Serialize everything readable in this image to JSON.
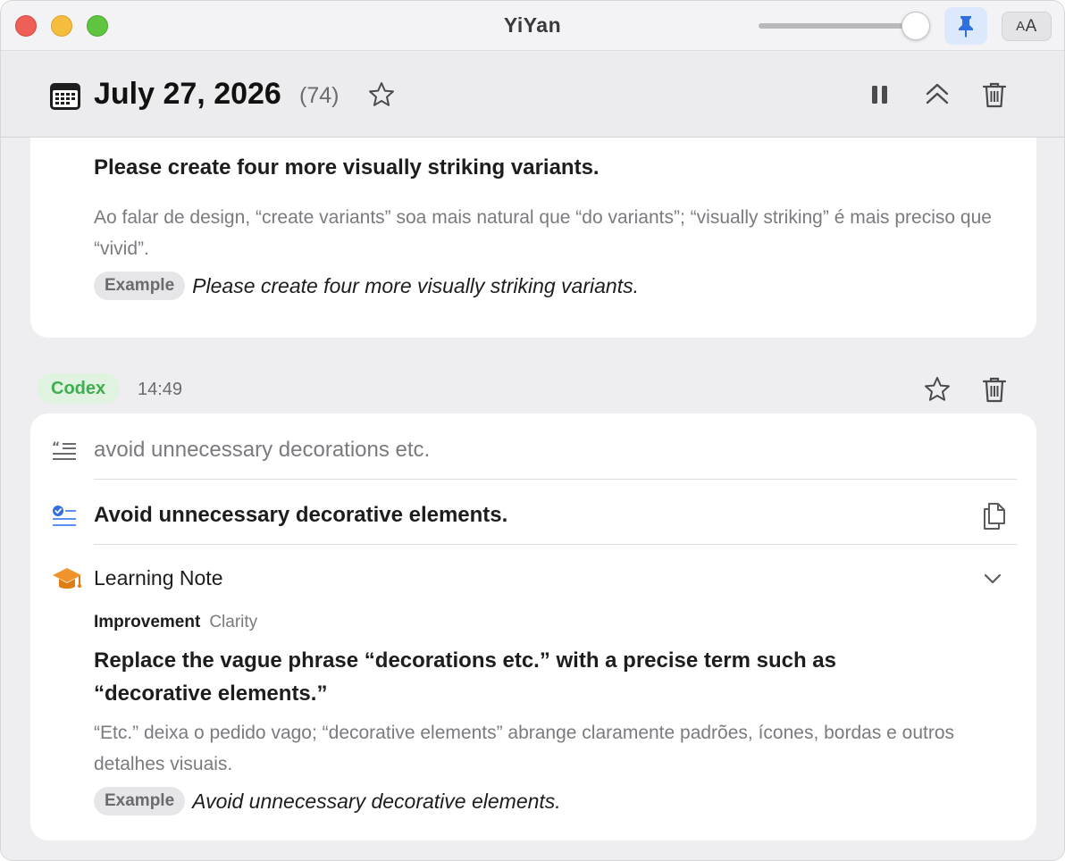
{
  "window": {
    "title": "YiYan",
    "font_button_large": "A",
    "font_button_small": "A"
  },
  "header": {
    "date": "July 27, 2026",
    "count": "(74)"
  },
  "entry_previous": {
    "corrected": "Please create four more visually striking variants.",
    "explanation": "Ao falar de design, “create variants” soa mais natural que “do variants”; “visually striking” é mais preciso que “vivid”.",
    "example_label": "Example",
    "example_text": "Please create four more visually striking variants."
  },
  "entry_current": {
    "source": "Codex",
    "time": "14:49",
    "original": "avoid unnecessary decorations etc.",
    "corrected": "Avoid unnecessary decorative elements.",
    "note": {
      "title": "Learning Note",
      "kind": "Improvement",
      "category": "Clarity",
      "headline": "Replace the vague phrase “decorations etc.” with a precise term such as “decorative elements.”",
      "explanation": "“Etc.” deixa o pedido vago; “decorative elements” abrange claramente padrões, ícones, bordas e outros detalhes visuais.",
      "example_label": "Example",
      "example_text": "Avoid unnecessary decorative elements."
    }
  },
  "colors": {
    "accent_blue": "#2f6fe0",
    "source_green": "#3fae4f",
    "note_orange": "#f0932b"
  }
}
